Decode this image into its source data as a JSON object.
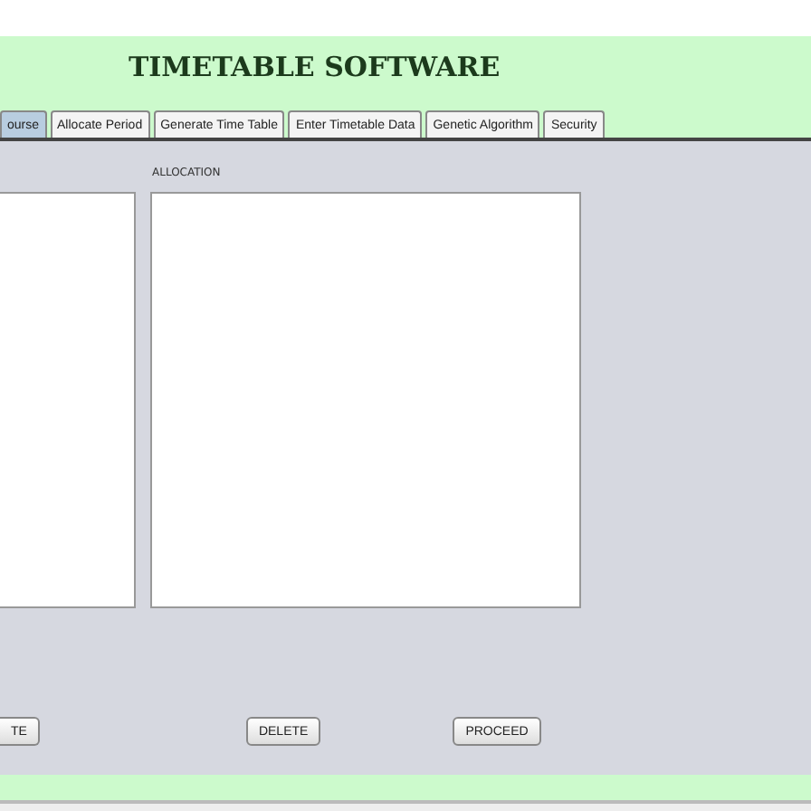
{
  "header": {
    "title": "TIMETABLE SOFTWARE"
  },
  "tabs": [
    {
      "label": "ourse",
      "selected": true
    },
    {
      "label": "Allocate Period",
      "selected": false
    },
    {
      "label": "Generate Time Table",
      "selected": false
    },
    {
      "label": "Enter Timetable Data",
      "selected": false
    },
    {
      "label": "Genetic Algorithm",
      "selected": false
    },
    {
      "label": "Security",
      "selected": false
    }
  ],
  "allocation_label": "ALLOCATION",
  "buttons": [
    "TE",
    "DELETE",
    "PROCEED"
  ]
}
